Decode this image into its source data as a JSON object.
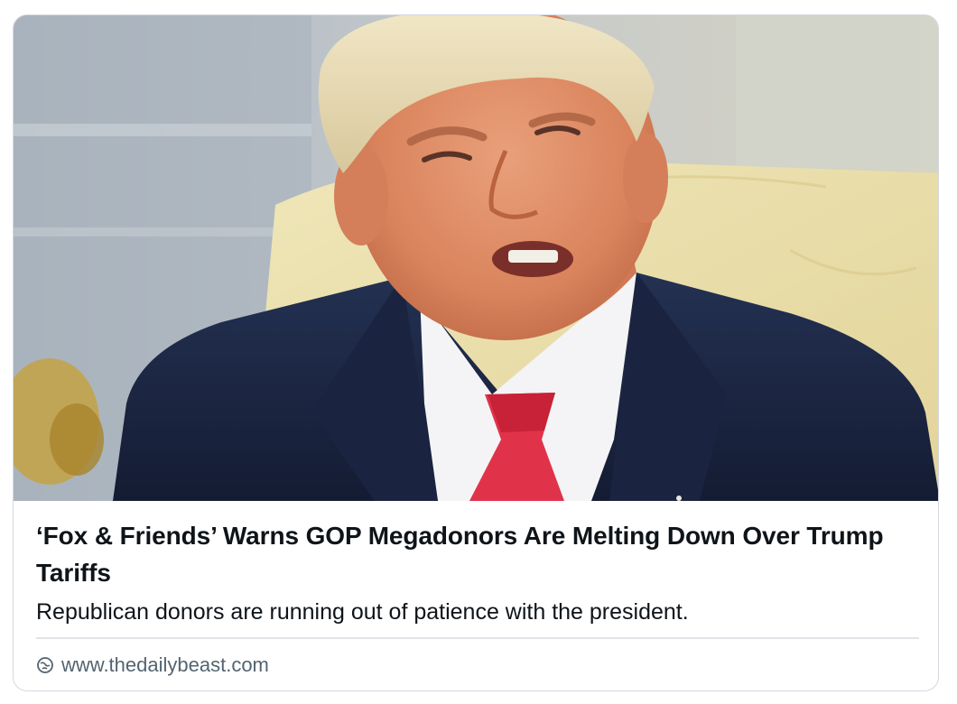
{
  "card": {
    "title": "‘Fox & Friends’ Warns GOP Megadonors Are Melting Down Over Trump Tariffs",
    "description": "Republican donors are running out of patience with the president.",
    "domain": "www.thedailybeast.com",
    "domain_icon": "link-globe-icon",
    "image_icon": "article-photo"
  },
  "colors": {
    "title_text": "#0f1419",
    "muted_text": "#536471",
    "border": "#d3d8df",
    "suit": "#1c2640",
    "tie": "#e0334a"
  }
}
